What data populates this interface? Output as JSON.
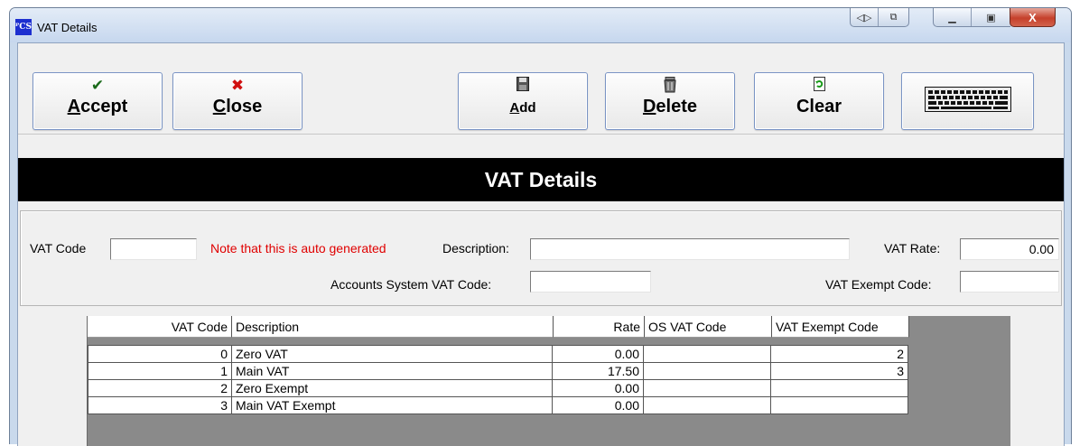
{
  "window": {
    "title": "VAT Details",
    "app_icon_text": "P CS"
  },
  "caption_buttons": {
    "nav_icon": "arrows-lr-icon",
    "snap_icon": "snap-icon",
    "minimize_icon": "minimize-icon",
    "maximize_icon": "maximize-icon",
    "close_label": "X"
  },
  "toolbar": {
    "accept": {
      "label": "Accept",
      "icon": "check-icon",
      "color": "#1a7a1a"
    },
    "close": {
      "label": "Close",
      "icon": "x-mark-icon",
      "color": "#d01010"
    },
    "add": {
      "label": "Add",
      "icon": "floppy-disk-icon"
    },
    "delete": {
      "label": "Delete",
      "icon": "trash-can-icon"
    },
    "clear": {
      "label": "Clear",
      "icon": "refresh-doc-icon"
    },
    "keyboard": {
      "icon": "keyboard-icon"
    }
  },
  "banner": {
    "title": "VAT Details"
  },
  "form": {
    "vat_code_label": "VAT Code",
    "vat_code_value": "",
    "auto_note": "Note that this is auto generated",
    "description_label": "Description:",
    "description_value": "",
    "vat_rate_label": "VAT Rate:",
    "vat_rate_value": "0.00",
    "accounts_code_label": "Accounts System VAT Code:",
    "accounts_code_value": "",
    "exempt_code_label": "VAT Exempt Code:",
    "exempt_code_value": ""
  },
  "grid": {
    "headers": [
      "VAT Code",
      "Description",
      "Rate",
      "OS VAT Code",
      "VAT Exempt Code"
    ],
    "rows": [
      {
        "code": "0",
        "description": "Zero VAT",
        "rate": "0.00",
        "os_code": "",
        "exempt_code": "2"
      },
      {
        "code": "1",
        "description": "Main VAT",
        "rate": "17.50",
        "os_code": "",
        "exempt_code": "3"
      },
      {
        "code": "2",
        "description": "Zero Exempt",
        "rate": "0.00",
        "os_code": "",
        "exempt_code": ""
      },
      {
        "code": "3",
        "description": "Main VAT Exempt",
        "rate": "0.00",
        "os_code": "",
        "exempt_code": ""
      }
    ]
  }
}
